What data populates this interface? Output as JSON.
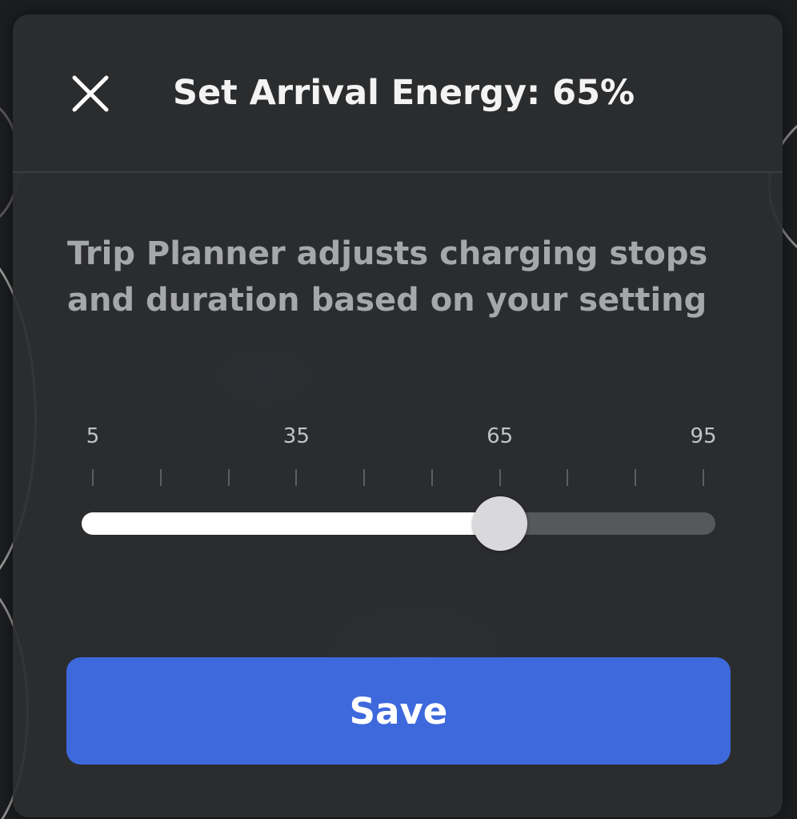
{
  "dialog": {
    "title": "Set Arrival Energy: 65%",
    "close_icon": "close-icon",
    "description": "Trip Planner adjusts charging stops and duration based on your setting"
  },
  "slider": {
    "min": 5,
    "max": 95,
    "value": 65,
    "tick_step": 10,
    "labels": [
      "5",
      "35",
      "65",
      "95"
    ],
    "label_values": [
      5,
      35,
      65,
      95
    ]
  },
  "save_button": {
    "label": "Save"
  },
  "colors": {
    "accent": "#3e69dd",
    "panel": "#2b2c2e",
    "slider_fill": "#ffffff",
    "slider_track": "#57585b"
  }
}
